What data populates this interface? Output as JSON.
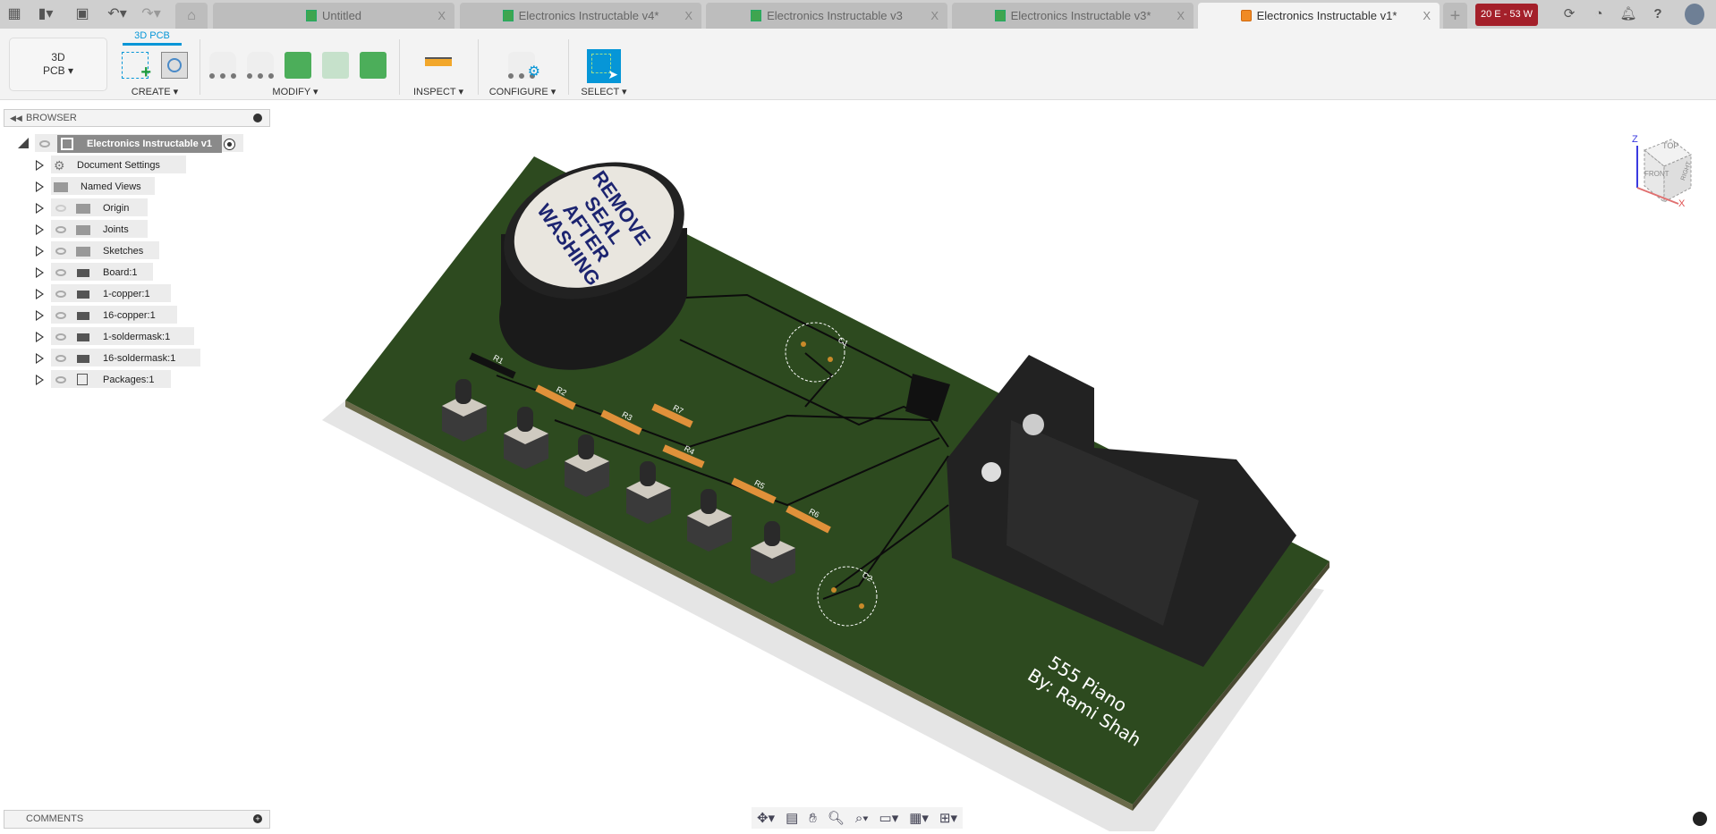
{
  "quick_access": {
    "grid": "apps-grid-icon",
    "file": "file-icon",
    "save": "save-icon",
    "undo": "undo-icon",
    "redo": "redo-icon"
  },
  "tabs": [
    {
      "label": "Untitled",
      "active": false
    },
    {
      "label": "Electronics Instructable v4*",
      "active": false
    },
    {
      "label": "Electronics Instructable v3",
      "active": false
    },
    {
      "label": "Electronics Instructable v3*",
      "active": false
    },
    {
      "label": "Electronics Instructable v1*",
      "active": true
    }
  ],
  "tab_close": "X",
  "new_tab": "+",
  "status_badge": {
    "label": "20 E - 53 W",
    "color": "#a4202a"
  },
  "workspace": {
    "label_line1": "3D",
    "label_line2": "PCB",
    "caret": "▾"
  },
  "toolbar": {
    "active_tab": "3D PCB",
    "accent": "#0696d7",
    "groups": [
      {
        "label": "CREATE ▾"
      },
      {
        "label": "MODIFY ▾"
      },
      {
        "label": "INSPECT ▾"
      },
      {
        "label": "CONFIGURE ▾"
      },
      {
        "label": "SELECT ▾"
      }
    ]
  },
  "browser": {
    "title": "BROWSER",
    "root": "Electronics Instructable v1",
    "items": [
      {
        "label": "Document Settings",
        "icon": "gear-icon"
      },
      {
        "label": "Named Views",
        "icon": "folder-icon"
      },
      {
        "label": "Origin",
        "icon": "folder-icon",
        "hidden": true
      },
      {
        "label": "Joints",
        "icon": "folder-icon"
      },
      {
        "label": "Sketches",
        "icon": "folder-icon"
      },
      {
        "label": "Board:1",
        "icon": "chip-icon"
      },
      {
        "label": "1-copper:1",
        "icon": "chip-icon"
      },
      {
        "label": "16-copper:1",
        "icon": "chip-icon"
      },
      {
        "label": "1-soldermask:1",
        "icon": "chip-icon"
      },
      {
        "label": "16-soldermask:1",
        "icon": "chip-icon"
      },
      {
        "label": "Packages:1",
        "icon": "component-icon"
      }
    ]
  },
  "comments": {
    "title": "COMMENTS"
  },
  "viewcube": {
    "top": "TOP",
    "front": "FRONT",
    "right": "RIGHT",
    "z": "Z",
    "x": "X"
  },
  "model": {
    "buzzer_text": [
      "REMOVE",
      "SEAL",
      "AFTER",
      "WASHING"
    ],
    "silk_labels": [
      "R1",
      "R2",
      "R3",
      "R7",
      "R4",
      "R5",
      "R6",
      "C1",
      "C2"
    ],
    "board_text_1": "555 Piano",
    "board_text_2": "By: Rami Shah",
    "board_color": "#2d4a1f"
  },
  "nav_tools": [
    "orbit-icon",
    "look-at-icon",
    "pan-icon",
    "zoom-icon",
    "fit-icon",
    "display-settings-icon",
    "grid-icon",
    "viewports-icon"
  ]
}
